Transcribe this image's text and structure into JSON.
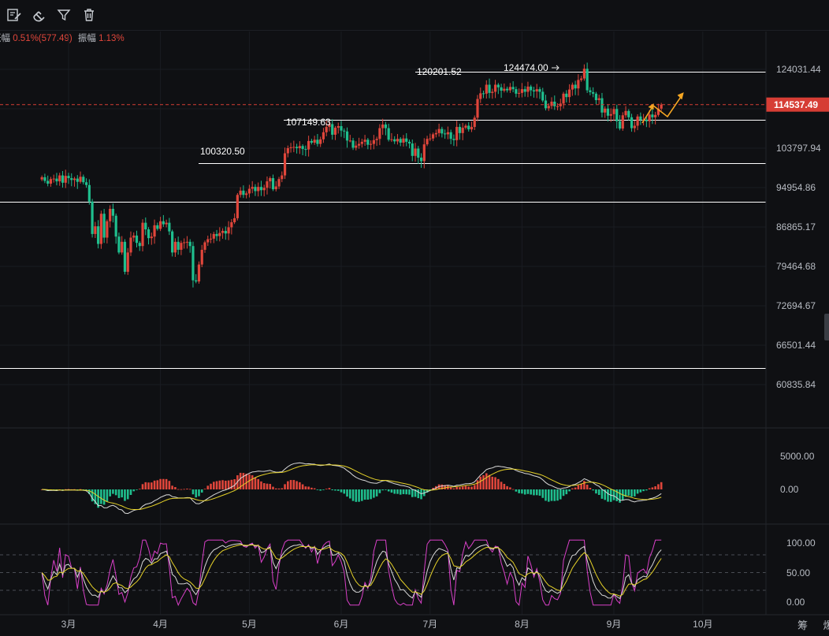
{
  "toolbar": {
    "icons": [
      "edit-note-icon",
      "magnet-icon",
      "filter-icon",
      "trash-icon"
    ]
  },
  "stats": {
    "change_label": "涨幅",
    "change_value": "0.51%(577.49)",
    "amplitude_label": "振幅",
    "amplitude_value": "1.13%"
  },
  "price_axis": {
    "ticks": [
      "124031.44",
      "114537.49",
      "103797.94",
      "94954.86",
      "86865.17",
      "79464.68",
      "72694.67",
      "66501.44",
      "60835.84"
    ]
  },
  "macd_axis": {
    "ticks": [
      "5000.00",
      "0.00"
    ]
  },
  "kdj_axis": {
    "ticks": [
      "100.00",
      "50.00",
      "0.00"
    ]
  },
  "time_axis": {
    "ticks": [
      "3月",
      "4月",
      "5月",
      "6月",
      "7月",
      "8月",
      "9月",
      "10月"
    ]
  },
  "corner_labels": "筹 爆",
  "level_labels": {
    "l1": "100320.50",
    "l2": "107149.63",
    "l3": "120201.52",
    "l4": "124474.00"
  },
  "colors": {
    "up": "#e0463b",
    "down": "#1fbf8e",
    "background": "#0f1013",
    "current_price_tag": "#d63d35",
    "arrow": "#f5a623",
    "level_line": "#ffffff",
    "kdj_j": "#d940c8",
    "kdj_d": "#e6d229",
    "kdj_k": "#d9d9d9"
  },
  "chart_data": {
    "type": "candlestick",
    "period": "daily",
    "start_date": "2025-02-20",
    "current_price": 114537.49,
    "price_axis_ticks": [
      124031.44,
      103797.94,
      94954.86,
      86865.17,
      79464.68,
      72694.67,
      66501.44,
      60835.84
    ],
    "support_resistance_lines": [
      123300,
      110700,
      100320.5,
      92000,
      63200
    ],
    "labeled_levels": [
      {
        "label": "100320.50",
        "value": 100320.5
      },
      {
        "label": "107149.63",
        "value": 107149.63
      },
      {
        "label": "120201.52",
        "value": 120201.52
      },
      {
        "label": "124474.00",
        "value": 124474.0
      }
    ],
    "closes": [
      97200,
      96400,
      95800,
      96800,
      96900,
      96300,
      97600,
      96000,
      97500,
      97000,
      96600,
      96900,
      96200,
      97300,
      96100,
      95500,
      92000,
      85500,
      87000,
      83600,
      89500,
      84800,
      88000,
      90500,
      89100,
      85000,
      82000,
      84000,
      78500,
      82000,
      84800,
      85200,
      83800,
      83200,
      87700,
      86400,
      84700,
      85000,
      87200,
      86500,
      88000,
      87400,
      87700,
      86000,
      82000,
      84000,
      82500,
      83800,
      83900,
      84000,
      83200,
      77000,
      76800,
      79800,
      82500,
      83900,
      84500,
      84600,
      85500,
      85100,
      85700,
      86100,
      85600,
      86800,
      87800,
      88600,
      93400,
      94300,
      93400,
      93700,
      94700,
      95100,
      94200,
      95100,
      94400,
      94900,
      96300,
      97000,
      94600,
      95200,
      96800,
      97600,
      102600,
      103800,
      104000,
      104100,
      103800,
      104300,
      103600,
      103500,
      105500,
      105100,
      105800,
      104800,
      105900,
      107600,
      108900,
      109600,
      107000,
      108700,
      109100,
      108000,
      107800,
      105600,
      105600,
      103900,
      104400,
      104800,
      105300,
      105800,
      104600,
      104800,
      105700,
      106000,
      108600,
      109500,
      108600,
      105800,
      105900,
      105400,
      106000,
      105100,
      106100,
      105300,
      104900,
      102000,
      103700,
      101600,
      100800,
      104700,
      106000,
      106100,
      107100,
      107400,
      108400,
      107300,
      107100,
      107600,
      106000,
      105700,
      108900,
      107400,
      108700,
      109200,
      108300,
      108900,
      111200,
      116000,
      117500,
      117400,
      119800,
      117600,
      117900,
      119800,
      119100,
      118200,
      118700,
      118300,
      119200,
      118600,
      117400,
      117600,
      118600,
      117900,
      119300,
      118300,
      118000,
      118600,
      117900,
      115600,
      113600,
      114200,
      115300,
      114100,
      114100,
      114800,
      117400,
      116500,
      118500,
      119800,
      118800,
      121100,
      121500,
      124200,
      118300,
      117800,
      117400,
      115700,
      116200,
      112500,
      113500,
      111700,
      112100,
      113400,
      110300,
      108500,
      111800,
      112900,
      111300,
      108600,
      109200,
      111500,
      110600,
      110700,
      110300,
      112000,
      111300,
      111900,
      113500,
      114537
    ]
  }
}
